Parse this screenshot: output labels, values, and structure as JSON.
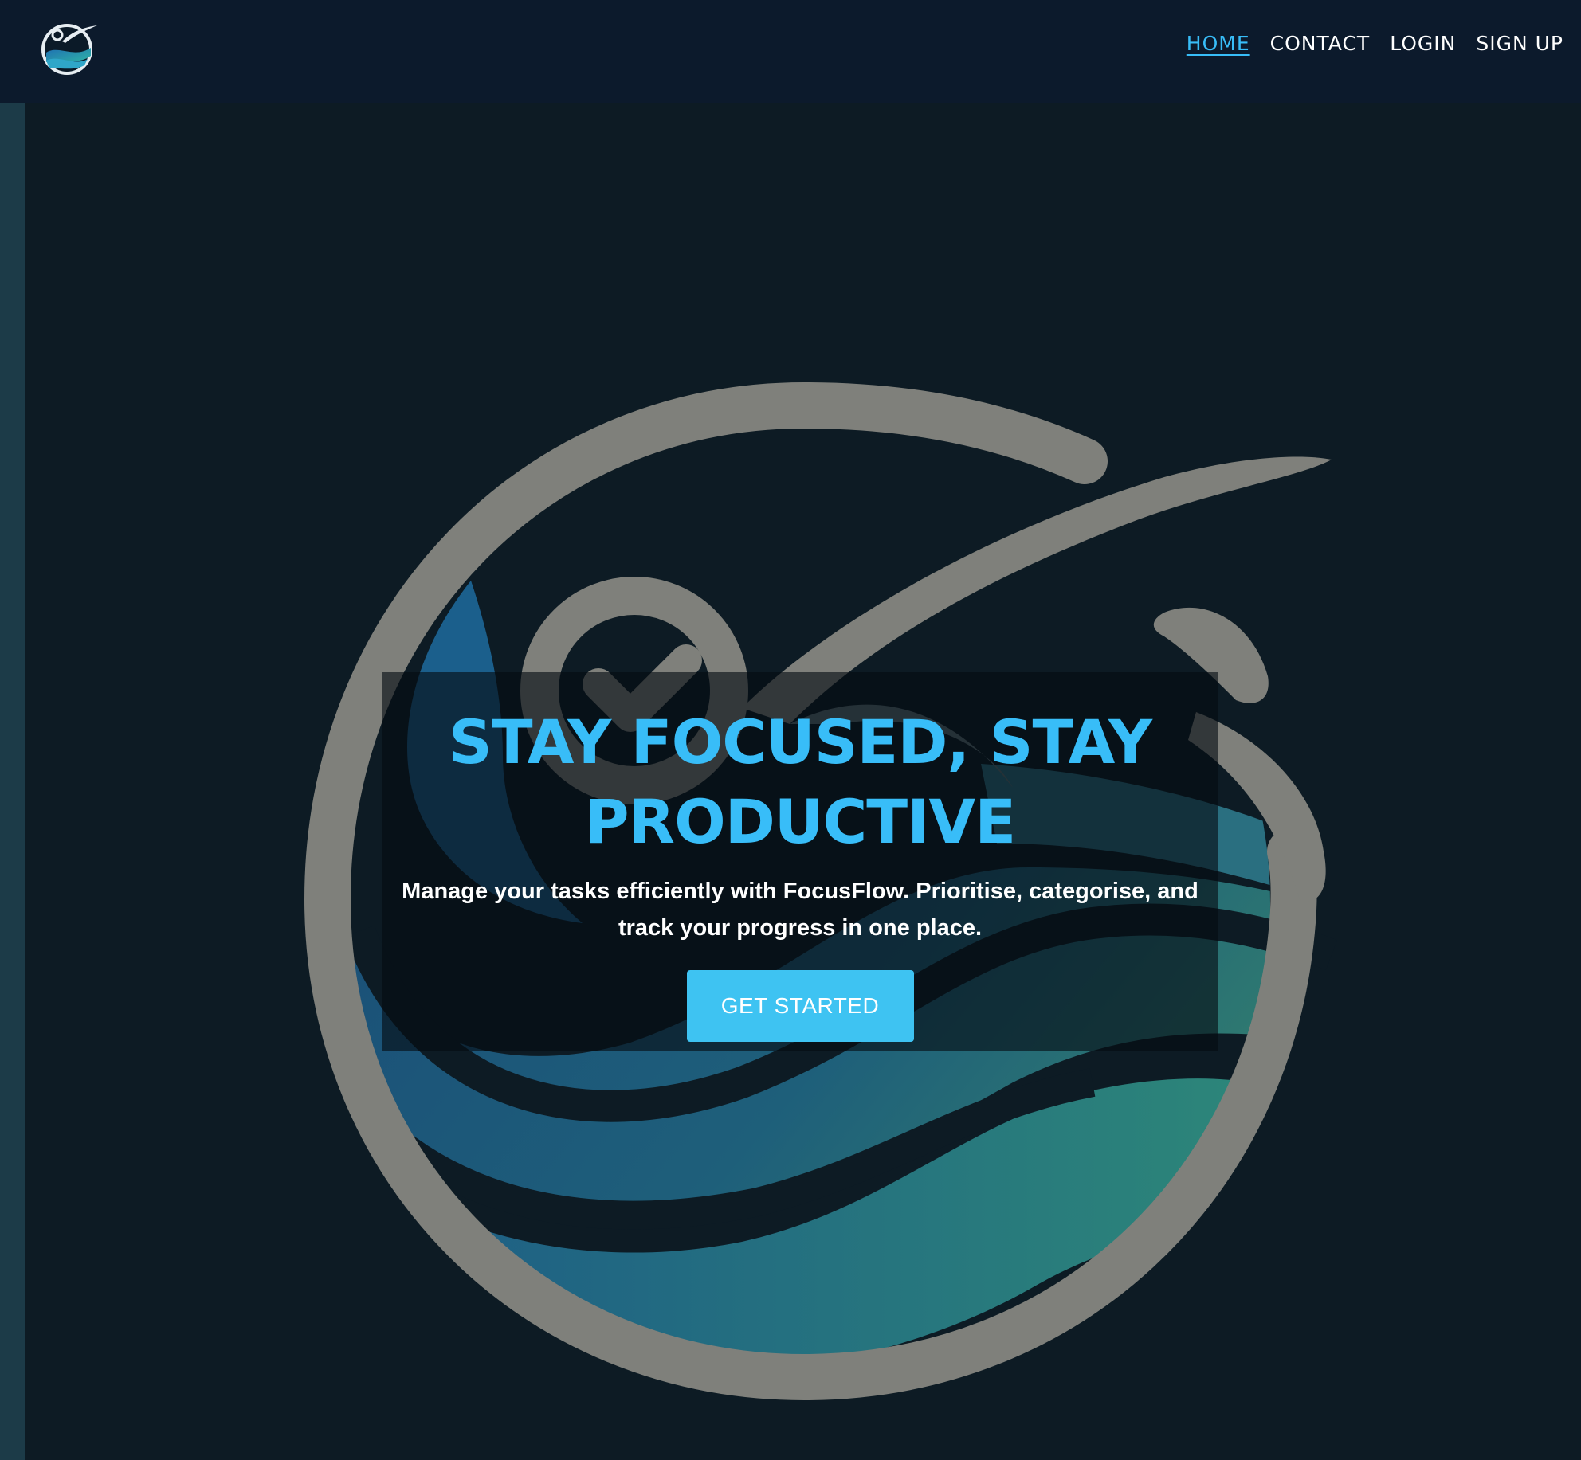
{
  "nav": {
    "logo_icon": "focusflow-logo-icon",
    "links": [
      {
        "label": "HOME",
        "active": true
      },
      {
        "label": "CONTACT",
        "active": false
      },
      {
        "label": "LOGIN",
        "active": false
      },
      {
        "label": "SIGN UP",
        "active": false
      }
    ]
  },
  "hero": {
    "background_icon": "focusflow-logo-watermark",
    "title": "STAY FOCUSED, STAY PRODUCTIVE",
    "subtitle": "Manage your tasks efficiently with FocusFlow. Prioritise, categorise, and track your progress in one place.",
    "cta_label": "GET STARTED"
  },
  "colors": {
    "accent": "#38bdf8",
    "nav_background": "#0c1a2c",
    "page_background": "#0d1b24",
    "button": "#3ec3f2"
  }
}
